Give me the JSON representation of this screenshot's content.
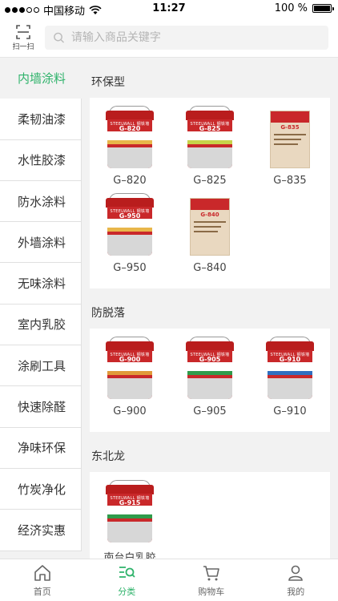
{
  "status": {
    "carrier": "中国移动",
    "time": "11:27",
    "battery": "100 %"
  },
  "header": {
    "scan_label": "扫一扫",
    "search_placeholder": "请输入商品关键字"
  },
  "sidebar": {
    "items": [
      {
        "label": "内墙涂料",
        "active": true
      },
      {
        "label": "柔韧油漆"
      },
      {
        "label": "水性胶漆"
      },
      {
        "label": "防水涂料"
      },
      {
        "label": "外墙涂料"
      },
      {
        "label": "无味涂料"
      },
      {
        "label": "室内乳胶"
      },
      {
        "label": "涂刷工具"
      },
      {
        "label": "快速除醛"
      },
      {
        "label": "净味环保"
      },
      {
        "label": "竹炭净化"
      },
      {
        "label": "经济实惠"
      }
    ]
  },
  "sections": [
    {
      "title": "环保型",
      "products": [
        {
          "name": "G–820",
          "kind": "bucket",
          "code": "G-820",
          "stripe": "#e8b64a"
        },
        {
          "name": "G–825",
          "kind": "bucket",
          "code": "G-825",
          "stripe": "#c7d34a"
        },
        {
          "name": "G–835",
          "kind": "bag",
          "code": "G-835"
        },
        {
          "name": "G–950",
          "kind": "bucket",
          "code": "G-950",
          "stripe": "#e8b64a"
        },
        {
          "name": "G–840",
          "kind": "bag",
          "code": "G-840"
        }
      ]
    },
    {
      "title": "防脱落",
      "products": [
        {
          "name": "G–900",
          "kind": "bucket",
          "code": "G-900",
          "stripe": "#e09a3a"
        },
        {
          "name": "G–905",
          "kind": "bucket",
          "code": "G-905",
          "stripe": "#2f9b4b"
        },
        {
          "name": "G–910",
          "kind": "bucket",
          "code": "G-910",
          "stripe": "#2f6fc0"
        }
      ]
    },
    {
      "title": "东北龙",
      "products": [
        {
          "name": "南台白乳胶",
          "kind": "bucket",
          "code": "G-915",
          "stripe": "#2f9b4b"
        }
      ]
    }
  ],
  "brand_text": "STEELWALL 钢铁墙",
  "tabs": [
    {
      "label": "首页",
      "icon": "home-icon"
    },
    {
      "label": "分类",
      "icon": "category-icon",
      "active": true
    },
    {
      "label": "购物车",
      "icon": "cart-icon"
    },
    {
      "label": "我的",
      "icon": "user-icon"
    }
  ],
  "colors": {
    "accent": "#2fb36b",
    "product_red": "#c9282a"
  }
}
